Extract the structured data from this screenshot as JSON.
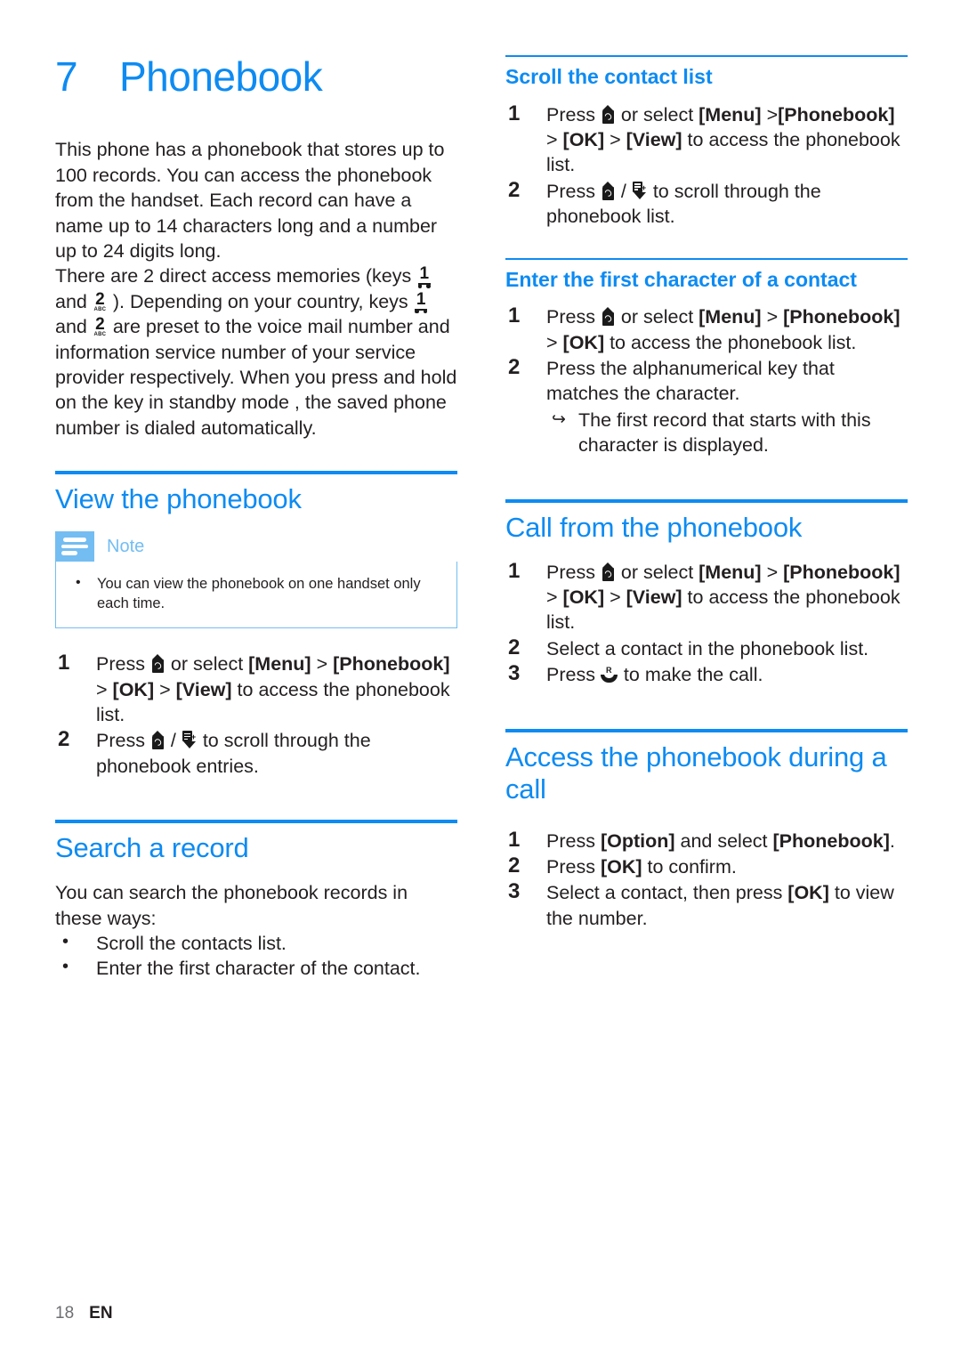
{
  "chapter": {
    "number": "7",
    "title": "Phonebook"
  },
  "intro": {
    "para1_a": "This phone has a phonebook that stores up to 100 records. You can access the phonebook from the handset. Each record can have a name up to 14 characters long and a number up to 24 digits long.",
    "para2_p1": "There are 2 direct access memories (keys ",
    "para2_p2": " and ",
    "para2_p3": " ). Depending on your country, keys ",
    "para2_p4": " and ",
    "para2_p5": " are preset to the voice mail number and information service number of your service provider respectively. When you press and hold on the key in standby mode , the saved phone number is dialed automatically."
  },
  "sections": {
    "view_phonebook": {
      "title": "View the phonebook",
      "note": {
        "label": "Note",
        "items": [
          "You can view the phonebook on one handset only each time."
        ]
      },
      "steps": [
        {
          "num": "1",
          "t1": "Press ",
          "t2": " or select ",
          "menu": "[Menu]",
          "sep1": " > ",
          "phonebook": "[Phonebook]",
          "sep2": " > ",
          "ok": "[OK]",
          "sep3": " > ",
          "view": "[View]",
          "tail": " to access the phonebook list."
        },
        {
          "num": "2",
          "t1": "Press ",
          "t2": " / ",
          "tail": " to scroll through the phonebook entries."
        }
      ]
    },
    "search_record": {
      "title": "Search a record",
      "intro": "You can search the phonebook records in these ways:",
      "bullets": [
        "Scroll the contacts list.",
        "Enter the first character of the contact."
      ]
    },
    "scroll_contact_list": {
      "title": "Scroll the contact list",
      "steps": [
        {
          "num": "1",
          "t1": "Press ",
          "t2": " or select ",
          "menu": "[Menu]",
          "sep1": " >",
          "phonebook": "[Phonebook]",
          "sep2": " > ",
          "ok": "[OK]",
          "sep3": " > ",
          "view": "[View]",
          "tail": " to access the phonebook list."
        },
        {
          "num": "2",
          "t1": "Press ",
          "t2": " / ",
          "tail": " to scroll through the phonebook list."
        }
      ]
    },
    "enter_first_character": {
      "title": "Enter the first character of a contact",
      "steps": [
        {
          "num": "1",
          "t1": "Press ",
          "t2": " or select ",
          "menu": "[Menu]",
          "sep1": " > ",
          "phonebook": "[Phonebook]",
          "sep2": " > ",
          "ok": "[OK]",
          "tail": " to access the phonebook list."
        },
        {
          "num": "2",
          "text": "Press the alphanumerical key that matches the character.",
          "result_arrow": "↪",
          "result": "The first record that starts with this character is displayed."
        }
      ]
    },
    "call_from_phonebook": {
      "title": "Call from the phonebook",
      "steps": [
        {
          "num": "1",
          "t1": "Press ",
          "t2": " or select ",
          "menu": "[Menu]",
          "sep1": " > ",
          "phonebook": "[Phonebook]",
          "sep2": " > ",
          "ok": "[OK]",
          "sep3": " > ",
          "view": "[View]",
          "tail": " to access the phonebook list."
        },
        {
          "num": "2",
          "text": "Select a contact in the phonebook list."
        },
        {
          "num": "3",
          "t1": "Press ",
          "tail": " to make the call."
        }
      ]
    },
    "access_during_call": {
      "title": "Access the phonebook during a call",
      "steps": [
        {
          "num": "1",
          "t1": "Press ",
          "option": "[Option]",
          "t2": " and select ",
          "phonebook": "[Phonebook]",
          "tail": "."
        },
        {
          "num": "2",
          "t1": "Press ",
          "ok": "[OK]",
          "tail": " to confirm."
        },
        {
          "num": "3",
          "t1": "Select a contact, then press ",
          "ok": "[OK]",
          "tail": " to view the number."
        }
      ]
    }
  },
  "keys": {
    "key1_digit": "1",
    "key2_digit": "2",
    "key2_sub": "ABC",
    "call_key_label": "R",
    "down_key_plus": "+"
  },
  "footer": {
    "page": "18",
    "language": "EN"
  },
  "colors": {
    "accent_blue": "#0d8bf2",
    "note_blue": "#73bdf2",
    "text": "#231f20",
    "page_number_gray": "#6d6e71"
  }
}
